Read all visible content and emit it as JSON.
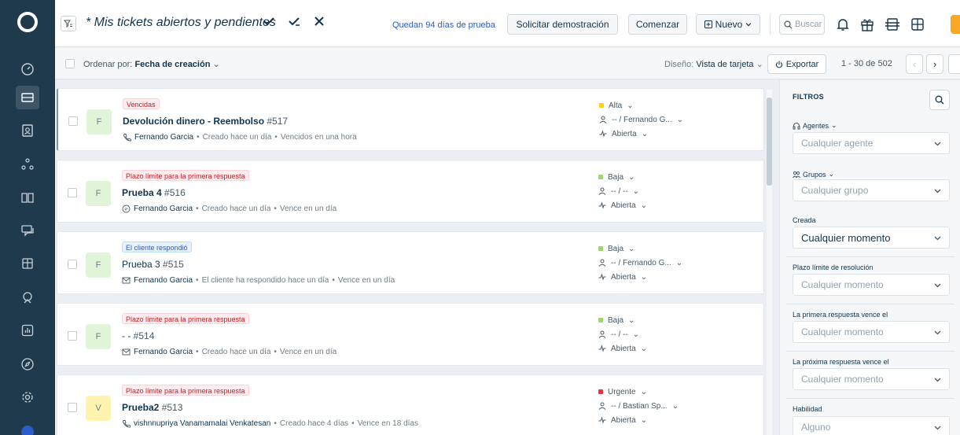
{
  "topbar": {
    "view_title": "* Mis tickets abiertos y pendientes",
    "trial_text": "Quedan 94 días de prueba",
    "demo_label": "Solicitar demostración",
    "start_label": "Comenzar",
    "new_label": "Nuevo",
    "search_label": "Buscar"
  },
  "subbar": {
    "sort_prefix": "Ordenar por:",
    "sort_value": "Fecha de creación",
    "layout_prefix": "Diseño:",
    "layout_value": "Vista de tarjeta",
    "export_label": "Exportar",
    "pagination": "1 - 30 de 502"
  },
  "tickets": [
    {
      "badge": "Vencidas",
      "badge_style": "red",
      "subject": "Devolución dinero - Reembolso",
      "number": "#517",
      "bold": true,
      "avatar": "F",
      "avatar_bg": "#e0f5d8",
      "source_icon": "phone-icon",
      "requester": "Fernando Garcia",
      "created": "Creado hace un día",
      "due": "Vencidos en una hora",
      "priority": "Alta",
      "priority_color": "#ffd012",
      "assignee": "-- / Fernando G...",
      "status": "Abierta"
    },
    {
      "badge": "Plazo límite para la primera respuesta",
      "badge_style": "red",
      "subject": "Prueba 4",
      "number": "#516",
      "bold": true,
      "avatar": "F",
      "avatar_bg": "#e0f5d8",
      "source_icon": "chat-icon",
      "requester": "Fernando Garcia",
      "created": "Creado hace un día",
      "due": "Vence en un día",
      "priority": "Baja",
      "priority_color": "#a0d76a",
      "assignee": "-- / --",
      "status": "Abierta"
    },
    {
      "badge": "El cliente respondió",
      "badge_style": "blue",
      "subject": "Prueba 3",
      "number": "#515",
      "bold": false,
      "avatar": "F",
      "avatar_bg": "#e0f5d8",
      "source_icon": "email-icon",
      "requester": "Fernando Garcia",
      "created": "El cliente ha respondido hace un día",
      "due": "Vence en un día",
      "priority": "Baja",
      "priority_color": "#a0d76a",
      "assignee": "-- / Fernando G...",
      "status": "Abierta"
    },
    {
      "badge": "Plazo límite para la primera respuesta",
      "badge_style": "red",
      "subject": "- -",
      "number": "#514",
      "bold": false,
      "avatar": "F",
      "avatar_bg": "#e0f5d8",
      "source_icon": "email-icon",
      "requester": "Fernando Garcia",
      "created": "Creado hace un día",
      "due": "Vence en un día",
      "priority": "Baja",
      "priority_color": "#a0d76a",
      "assignee": "-- / --",
      "status": "Abierta"
    },
    {
      "badge": "Plazo límite para la primera respuesta",
      "badge_style": "red",
      "subject": "Prueba2",
      "number": "#513",
      "bold": true,
      "avatar": "V",
      "avatar_bg": "#fff3b0",
      "source_icon": "phone-icon",
      "requester": "vishnnupriya Vanamamalai Venkatesan",
      "created": "Creado hace 4 días",
      "due": "Vence en 18 días",
      "priority": "Urgente",
      "priority_color": "#e43538",
      "assignee": "-- / Bastian Sp...",
      "status": "Abierta"
    }
  ],
  "filters": {
    "heading": "FILTROS",
    "agents_label": "Agentes",
    "agents_value": "Cualquier agente",
    "groups_label": "Grupos",
    "groups_value": "Cualquier grupo",
    "created_label": "Creada",
    "created_value": "Cualquier momento",
    "resolution_label": "Plazo límite de resolución",
    "resolution_value": "Cualquier momento",
    "first_resp_label": "La primera respuesta vence el",
    "first_resp_value": "Cualquier momento",
    "next_resp_label": "La próxima respuesta vence el",
    "next_resp_value": "Cualquier momento",
    "skill_label": "Habilidad",
    "skill_value": "Alguno"
  },
  "colors": {
    "rail": "#1f3a4d",
    "accent": "#2c5cc5",
    "brand_orange": "#f9a825"
  }
}
